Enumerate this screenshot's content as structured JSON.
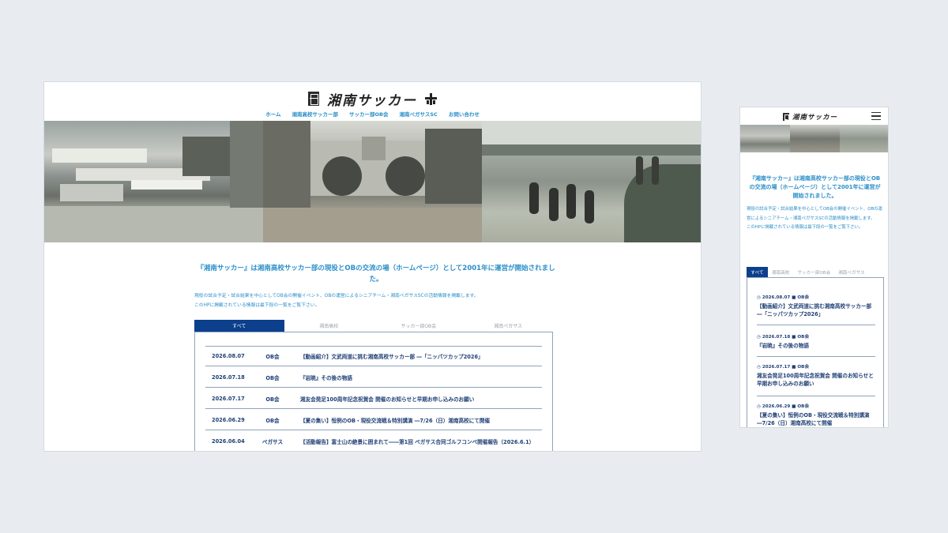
{
  "site": {
    "brand": "湘南サッカー",
    "nav": [
      "ホーム",
      "湘南高校サッカー部",
      "サッカー部OB会",
      "湘南ペガサスSC",
      "お問い合わせ"
    ]
  },
  "intro": {
    "lead": "『湘南サッカー』は湘南高校サッカー部の現役とOBの交流の場（ホームページ）として2001年に運営が開始されました。",
    "desc": [
      "現役の試合予定・試合結果を中心としてOB会の開催イベント、OBの運営によるシニアチーム・湘南ペガサスSCの活動情報を掲載します。",
      "このHPに掲載されている情報は最下段の一覧をご覧下さい。"
    ]
  },
  "tabs": [
    "すべて",
    "湘南高校",
    "サッカー部OB会",
    "湘南ペガサス"
  ],
  "news": [
    {
      "date": "2026.08.07",
      "cat": "OB会",
      "title": "【動画紹介】文武両道に挑む湘南高校サッカー部 ―「ニッパツカップ2026」"
    },
    {
      "date": "2026.07.18",
      "cat": "OB会",
      "title": "『岩暁』その後の物語"
    },
    {
      "date": "2026.07.17",
      "cat": "OB会",
      "title": "湘友会発足100周年記念祝賀会 開催のお知らせと早期お申し込みのお願い"
    },
    {
      "date": "2026.06.29",
      "cat": "OB会",
      "title": "【夏の集い】恒例のOB・現役交流戦＆特別講演 ―7/26（日）湘南高校にて開催"
    },
    {
      "date": "2026.06.04",
      "cat": "ペガサス",
      "title": "【活動報告】富士山の絶景に囲まれて――第1回 ペガサス合同ゴルフコンペ開催報告（2026.6.1）"
    }
  ],
  "mobile": {
    "desc": [
      "現役の試合予定・試合結果を中心としてOB会の開催イベント、OBの運営によるシニアチーム・湘南ペガサスSCの活動情報を掲載します。",
      "このHPに掲載されている情報は最下段の一覧をご覧下さい。"
    ],
    "tabs": [
      "すべて",
      "湘南高校",
      "サッカー部OB会",
      "湘南ペガサス"
    ],
    "news": [
      {
        "date": "2026.08.07",
        "cat": "OB会",
        "title": "【動画紹介】文武両道に挑む湘南高校サッカー部 ―「ニッパツカップ2026」"
      },
      {
        "date": "2026.07.18",
        "cat": "OB会",
        "title": "『岩暁』その後の物語"
      },
      {
        "date": "2026.07.17",
        "cat": "OB会",
        "title": "湘友会発足100周年記念祝賀会 開催のお知らせと早期お申し込みのお願い"
      },
      {
        "date": "2026.06.29",
        "cat": "OB会",
        "title": "【夏の集い】恒例のOB・現役交流戦＆特別講演 ―7/26（日）湘南高校にて開催"
      }
    ]
  },
  "colors": {
    "accent": "#2a8fc9",
    "navy": "#0c3f8c",
    "text": "#1e3f75"
  }
}
